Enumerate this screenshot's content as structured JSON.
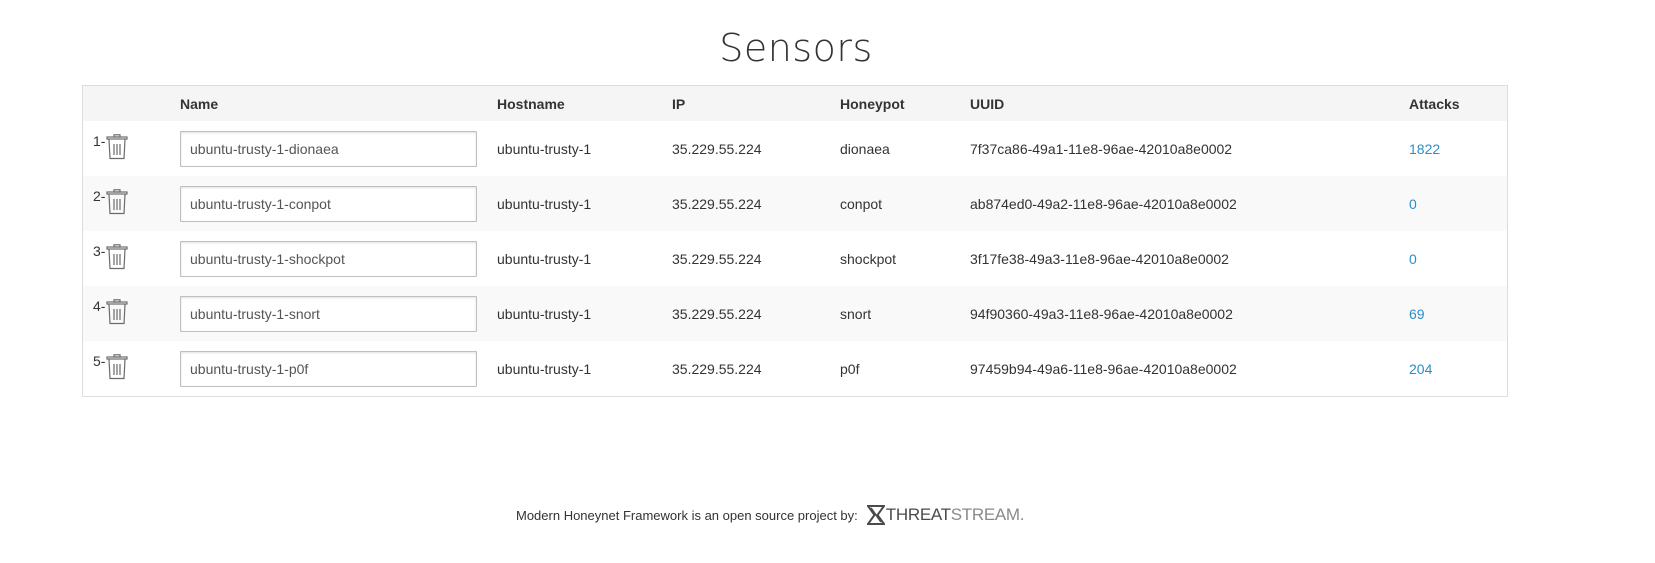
{
  "page": {
    "title": "Sensors"
  },
  "table": {
    "headers": {
      "index": "",
      "name": "Name",
      "hostname": "Hostname",
      "ip": "IP",
      "honeypot": "Honeypot",
      "uuid": "UUID",
      "attacks": "Attacks"
    },
    "rows": [
      {
        "index": "1-",
        "name": "ubuntu-trusty-1-dionaea",
        "hostname": "ubuntu-trusty-1",
        "ip": "35.229.55.224",
        "honeypot": "dionaea",
        "uuid": "7f37ca86-49a1-11e8-96ae-42010a8e0002",
        "attacks": "1822"
      },
      {
        "index": "2-",
        "name": "ubuntu-trusty-1-conpot",
        "hostname": "ubuntu-trusty-1",
        "ip": "35.229.55.224",
        "honeypot": "conpot",
        "uuid": "ab874ed0-49a2-11e8-96ae-42010a8e0002",
        "attacks": "0"
      },
      {
        "index": "3-",
        "name": "ubuntu-trusty-1-shockpot",
        "hostname": "ubuntu-trusty-1",
        "ip": "35.229.55.224",
        "honeypot": "shockpot",
        "uuid": "3f17fe38-49a3-11e8-96ae-42010a8e0002",
        "attacks": "0"
      },
      {
        "index": "4-",
        "name": "ubuntu-trusty-1-snort",
        "hostname": "ubuntu-trusty-1",
        "ip": "35.229.55.224",
        "honeypot": "snort",
        "uuid": "94f90360-49a3-11e8-96ae-42010a8e0002",
        "attacks": "69"
      },
      {
        "index": "5-",
        "name": "ubuntu-trusty-1-p0f",
        "hostname": "ubuntu-trusty-1",
        "ip": "35.229.55.224",
        "honeypot": "p0f",
        "uuid": "97459b94-49a6-11e8-96ae-42010a8e0002",
        "attacks": "204"
      }
    ]
  },
  "footer": {
    "text": "Modern Honeynet Framework is an open source project by:",
    "logo_part1": "THREAT",
    "logo_part2": "STREAM."
  },
  "icons": {
    "delete": "trash-icon",
    "logo_mark": "threatstream-logo-icon"
  },
  "colors": {
    "link": "#2a8fc7",
    "header_bg": "#f5f5f5",
    "stripe_bg": "#f9f9f9",
    "border": "#dddddd"
  }
}
